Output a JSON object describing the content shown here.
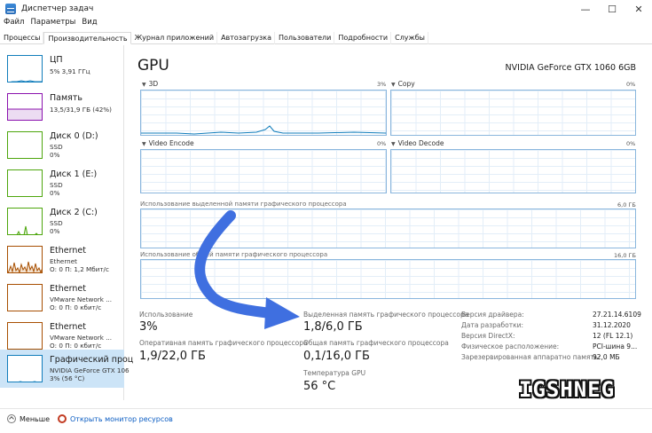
{
  "window": {
    "title": "Диспетчер задач",
    "controls": {
      "minimize": "—",
      "maximize": "☐",
      "close": "✕"
    }
  },
  "menu": [
    "Файл",
    "Параметры",
    "Вид"
  ],
  "tabs": [
    {
      "label": "Процессы",
      "active": false
    },
    {
      "label": "Производительность",
      "active": true
    },
    {
      "label": "Журнал приложений",
      "active": false
    },
    {
      "label": "Автозагрузка",
      "active": false
    },
    {
      "label": "Пользователи",
      "active": false
    },
    {
      "label": "Подробности",
      "active": false
    },
    {
      "label": "Службы",
      "active": false
    }
  ],
  "sidebar": [
    {
      "name": "ЦП",
      "lines": [
        "5% 3,91 ГГц"
      ],
      "color": "#117dbb"
    },
    {
      "name": "Память",
      "lines": [
        "13,5/31,9 ГБ (42%)"
      ],
      "color": "#8b12ae"
    },
    {
      "name": "Диск 0 (D:)",
      "lines": [
        "SSD",
        "0%"
      ],
      "color": "#4da60c"
    },
    {
      "name": "Диск 1 (E:)",
      "lines": [
        "SSD",
        "0%"
      ],
      "color": "#4da60c"
    },
    {
      "name": "Диск 2 (C:)",
      "lines": [
        "SSD",
        "0%"
      ],
      "color": "#4da60c"
    },
    {
      "name": "Ethernet",
      "lines": [
        "Ethernet",
        "О: 0 П: 1,2 Мбит/с"
      ],
      "color": "#a74f01"
    },
    {
      "name": "Ethernet",
      "lines": [
        "VMware Network ...",
        "О: 0 П: 0 кбит/с"
      ],
      "color": "#a74f01"
    },
    {
      "name": "Ethernet",
      "lines": [
        "VMware Network ...",
        "О: 0 П: 0 кбит/с"
      ],
      "color": "#a74f01"
    },
    {
      "name": "Графический проц",
      "lines": [
        "NVIDIA GeForce GTX 106",
        "3% (56 °C)"
      ],
      "color": "#117dbb",
      "selected": true
    }
  ],
  "main": {
    "title": "GPU",
    "model": "NVIDIA GeForce GTX 1060 6GB",
    "engines": [
      {
        "label": "3D",
        "pct": "3%"
      },
      {
        "label": "Copy",
        "pct": "0%"
      },
      {
        "label": "Video Encode",
        "pct": "0%"
      },
      {
        "label": "Video Decode",
        "pct": "0%"
      }
    ],
    "dedicated_graph": {
      "label": "Использование выделенной памяти графического процессора",
      "max": "6,0 ГБ"
    },
    "shared_graph": {
      "label": "Использование общей памяти графического процессора",
      "max": "16,0 ГБ"
    },
    "stats": {
      "usage_label": "Использование",
      "usage_value": "3%",
      "gpu_mem_label": "Оперативная память графического процессора",
      "gpu_mem_value": "1,9/22,0 ГБ",
      "dedicated_label": "Выделенная память графического процессора",
      "dedicated_value": "1,8/6,0 ГБ",
      "shared_label": "Общая память графического процессора",
      "shared_value": "0,1/16,0 ГБ",
      "temp_label": "Температура GPU",
      "temp_value": "56 °C"
    },
    "info": [
      {
        "k": "Версия драйвера:",
        "v": "27.21.14.6109"
      },
      {
        "k": "Дата разработки:",
        "v": "31.12.2020"
      },
      {
        "k": "Версия DirectX:",
        "v": "12 (FL 12.1)"
      },
      {
        "k": "Физическое расположение:",
        "v": "PCI-шина 9..."
      },
      {
        "k": "Зарезервированная аппаратно память:",
        "v": "92,0 МБ"
      }
    ]
  },
  "footer": {
    "less": "Меньше",
    "monitor": "Открыть монитор ресурсов"
  },
  "watermark": "IGSHNEG",
  "colors": {
    "graph_border": "#8ab6dd",
    "selected_bg": "#cce4f7",
    "arrow": "#3f6fe0",
    "link": "#0a5cc2"
  }
}
